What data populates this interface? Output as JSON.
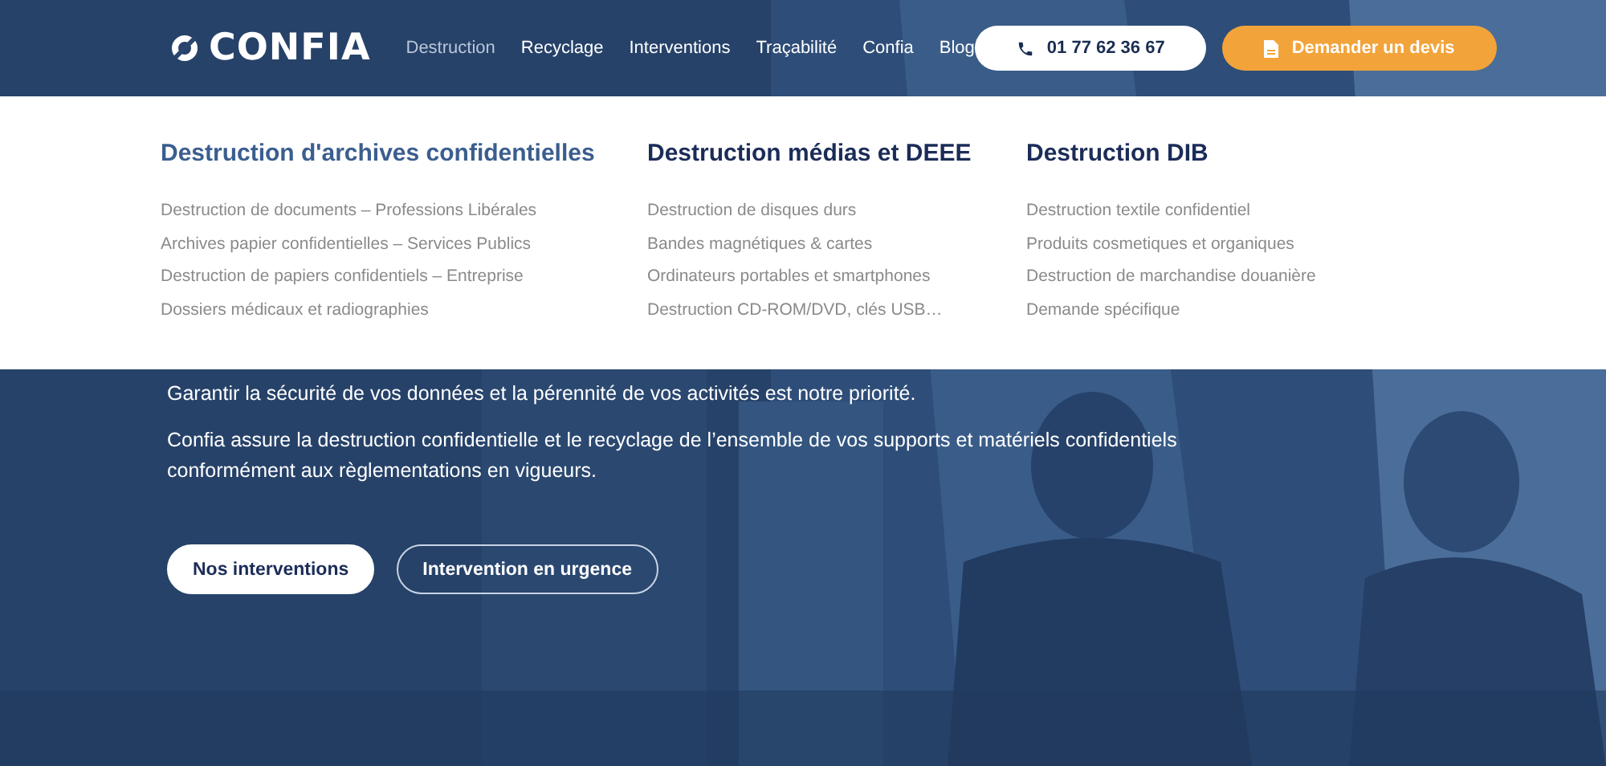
{
  "header": {
    "logo": "CONFIA",
    "nav": [
      {
        "label": "Destruction",
        "selected": true
      },
      {
        "label": "Recyclage",
        "selected": false
      },
      {
        "label": "Interventions",
        "selected": false
      },
      {
        "label": "Traçabilité",
        "selected": false
      },
      {
        "label": "Confia",
        "selected": false
      },
      {
        "label": "Blog",
        "selected": false
      }
    ],
    "phone_button": "01 77 62 36 67",
    "quote_button": "Demander un devis"
  },
  "mega_menu": {
    "columns": [
      {
        "heading": "Destruction d'archives confidentielles",
        "selected": true,
        "items": [
          "Destruction de documents – Professions Libérales",
          "Archives papier confidentielles – Services Publics",
          "Destruction de papiers confidentiels – Entreprise",
          "Dossiers médicaux et radiographies"
        ]
      },
      {
        "heading": "Destruction médias et DEEE",
        "selected": false,
        "items": [
          "Destruction de disques durs",
          "Bandes magnétiques & cartes",
          "Ordinateurs portables et smartphones",
          "Destruction CD-ROM/DVD, clés USB…"
        ]
      },
      {
        "heading": "Destruction DIB",
        "selected": false,
        "items": [
          "Destruction textile confidentiel",
          "Produits cosmetiques et organiques",
          "Destruction de marchandise douanière",
          "Demande spécifique"
        ]
      }
    ]
  },
  "hero": {
    "kind": "picture",
    "paragraphs": [
      "Garantir la sécurité de vos données et la pérennité de vos activités est notre priorité.",
      "Confia assure la destruction confidentielle et le recyclage de l’ensemble de vos supports et matériels confidentiels conformément aux règlementations en vigueurs."
    ],
    "buttons": [
      {
        "label": "Nos interventions",
        "kind": "solid"
      },
      {
        "label": "Intervention en urgence",
        "kind": "outline"
      }
    ]
  }
}
